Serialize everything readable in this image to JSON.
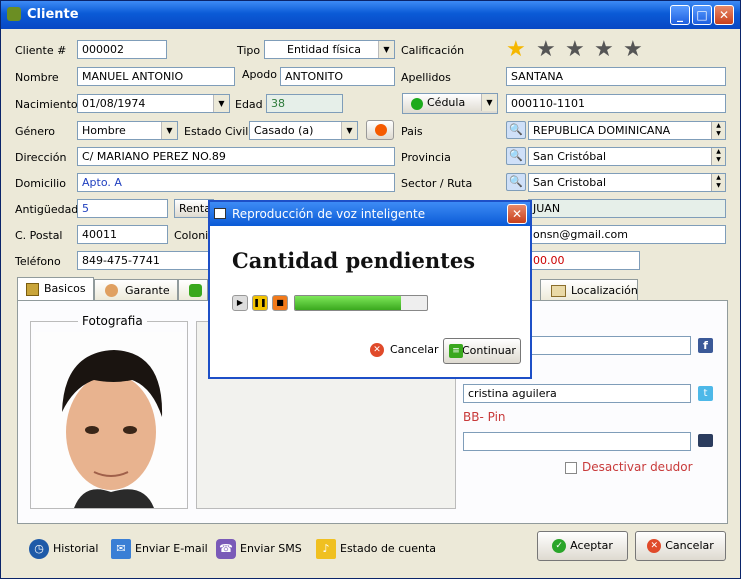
{
  "window": {
    "title": "Cliente",
    "min": "_",
    "max": "□",
    "close": "✕"
  },
  "form": {
    "cliente_label": "Cliente #",
    "cliente": "000002",
    "tipo_label": "Tipo",
    "tipo": "Entidad física",
    "calif_label": "Calificación",
    "rating": 1,
    "rating_max": 5,
    "nombre_label": "Nombre",
    "nombre": "MANUEL ANTONIO",
    "apodo_label": "Apodo",
    "apodo": "ANTONITO",
    "apellidos_label": "Apellidos",
    "apellidos": "SANTANA",
    "nac_label": "Nacimiento",
    "nac": "01/08/1974",
    "edad_label": "Edad",
    "edad": "38",
    "doc_type": "Cédula",
    "doc": "000110-1101",
    "genero_label": "Género",
    "genero": "Hombre",
    "estado_label": "Estado  Civil",
    "estado": "Casado (a)",
    "pais_label": "Pais",
    "pais": "REPUBLICA DOMINICANA",
    "dir_label": "Dirección",
    "dir": "C/ MARIANO PEREZ NO.89",
    "prov_label": "Provincia",
    "prov": "San Cristóbal",
    "dom_label": "Domicilio",
    "dom": "Apto. A",
    "sector_label": "Sector / Ruta",
    "sector": "San Cristobal",
    "antig_label": "Antigüedad",
    "antig": "5",
    "renta_label": "Renta",
    "juan": "JUAN",
    "cp_label": "C. Postal",
    "cp": "40011",
    "colonia_label": "Colonia",
    "email": "onsn@gmail.com",
    "tel_label": "Teléfono",
    "tel": "849-475-7741",
    "monto": "00.00"
  },
  "tabs": [
    "Basicos",
    "Garante",
    "Localización"
  ],
  "panel": {
    "foto_label": "Fotografia",
    "twitter": "cristina aguilera",
    "bb_label": "BB- Pin",
    "desactivar": "Desactivar deudor"
  },
  "bottom": {
    "historial": "Historial",
    "email": "Enviar E-mail",
    "sms": "Enviar SMS",
    "estado": "Estado de cuenta",
    "aceptar": "Aceptar",
    "cancelar": "Cancelar"
  },
  "dialog": {
    "title": "Reproducción de voz inteligente",
    "heading": "Cantidad pendientes",
    "progress": 0.8,
    "cancel": "Cancelar",
    "continue": "Continuar",
    "close": "✕"
  },
  "colors": {
    "title": "#0a5ad6",
    "star_on": "#f5b700",
    "progress": "#3aa81e"
  }
}
